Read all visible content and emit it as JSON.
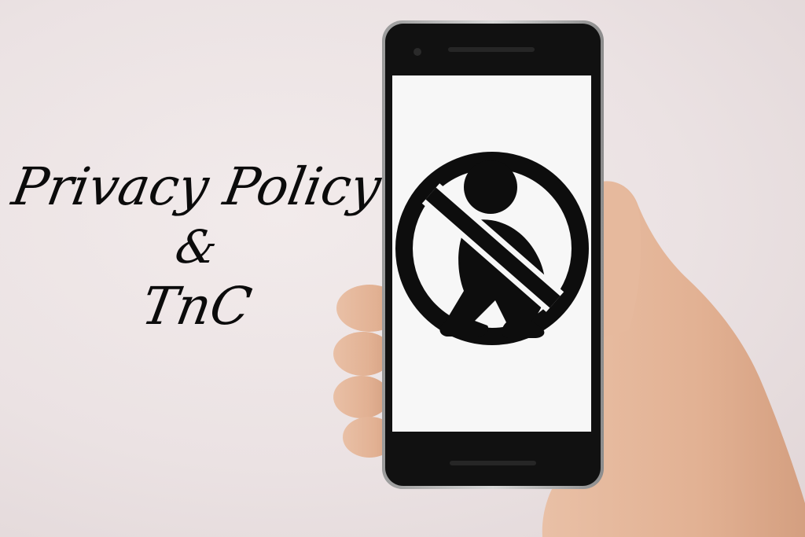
{
  "overlay_text": {
    "line1": "Privacy Policy",
    "line2": "&",
    "line3": "TnC"
  },
  "icon": {
    "name": "no-tracking-prohibition-icon"
  },
  "colors": {
    "background": "#ebe2e3",
    "text": "#0b0b0b",
    "phone_body": "#111111",
    "phone_screen": "#f7f7f7",
    "skin": "#e2b59a"
  }
}
